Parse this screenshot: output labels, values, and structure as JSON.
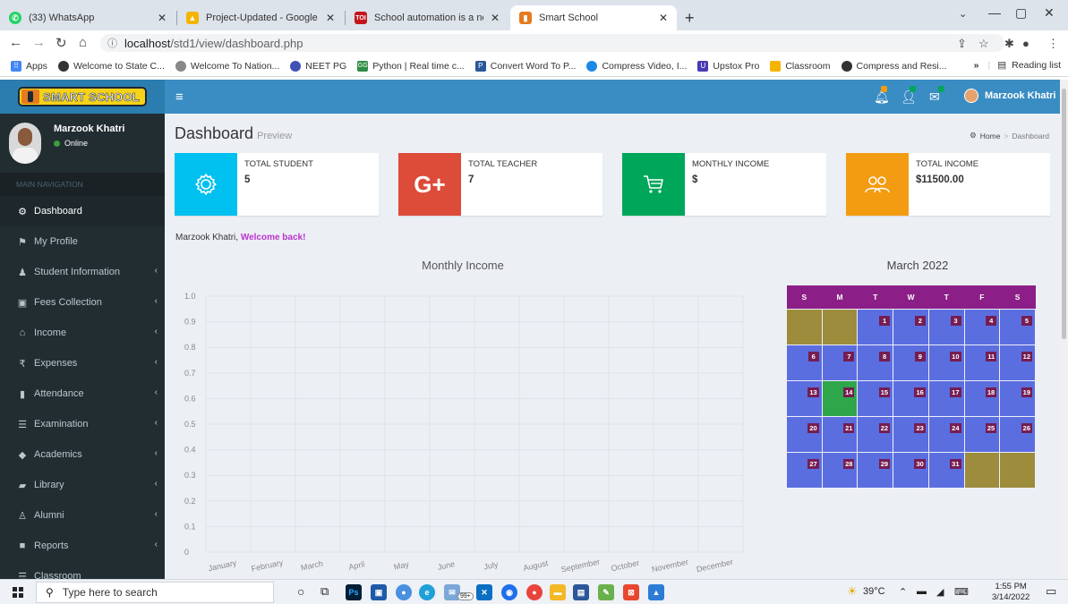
{
  "browser": {
    "tabs": [
      {
        "title": "(33) WhatsApp",
        "favicon": "whatsapp-icon",
        "color": "#25d366"
      },
      {
        "title": "Project-Updated - Google Drive",
        "favicon": "google-drive-icon",
        "color": "#f4b400"
      },
      {
        "title": "School automation is a new norm",
        "favicon": "toi-icon",
        "color": "#c4161c"
      },
      {
        "title": "Smart School",
        "favicon": "smart-school-icon",
        "color": "#e47b20"
      }
    ],
    "url_host": "localhost",
    "url_path": "/std1/view/dashboard.php",
    "bookmarks": [
      {
        "label": "Apps",
        "color": "#4285f4"
      },
      {
        "label": "Welcome to State C...",
        "color": "#333333"
      },
      {
        "label": "Welcome To Nation...",
        "color": "#888888"
      },
      {
        "label": "NEET PG",
        "color": "#3f51b5"
      },
      {
        "label": "Python | Real time c...",
        "color": "#2f8d46"
      },
      {
        "label": "Convert Word To P...",
        "color": "#2b579a"
      },
      {
        "label": "Compress Video, I...",
        "color": "#1e88e5"
      },
      {
        "label": "Upstox Pro",
        "color": "#4a3ab5"
      },
      {
        "label": "Classroom",
        "color": "#f4b400"
      },
      {
        "label": "Compress and Resi...",
        "color": "#333333"
      }
    ],
    "reading_list": "Reading list"
  },
  "app": {
    "logo_text": "SMART SCHOOL",
    "user_name": "Marzook Khatri"
  },
  "sidebar": {
    "user_name": "Marzook Khatri",
    "status": "Online",
    "nav_header": "MAIN NAVIGATION",
    "items": [
      {
        "label": "Dashboard",
        "icon": "dashboard-icon",
        "active": true,
        "arrow": false
      },
      {
        "label": "My Profile",
        "icon": "flag-icon",
        "active": false,
        "arrow": false
      },
      {
        "label": "Student Information",
        "icon": "user-icon",
        "active": false,
        "arrow": true
      },
      {
        "label": "Fees Collection",
        "icon": "money-icon",
        "active": false,
        "arrow": true
      },
      {
        "label": "Income",
        "icon": "bank-icon",
        "active": false,
        "arrow": true
      },
      {
        "label": "Expenses",
        "icon": "rupee-icon",
        "active": false,
        "arrow": true
      },
      {
        "label": "Attendance",
        "icon": "bookmark-icon",
        "active": false,
        "arrow": true
      },
      {
        "label": "Examination",
        "icon": "list-icon",
        "active": false,
        "arrow": true
      },
      {
        "label": "Academics",
        "icon": "tag-icon",
        "active": false,
        "arrow": true
      },
      {
        "label": "Library",
        "icon": "book-icon",
        "active": false,
        "arrow": true
      },
      {
        "label": "Alumni",
        "icon": "graduate-icon",
        "active": false,
        "arrow": true
      },
      {
        "label": "Reports",
        "icon": "briefcase-icon",
        "active": false,
        "arrow": true
      },
      {
        "label": "Classroom",
        "icon": "list-icon",
        "active": false,
        "arrow": false
      }
    ]
  },
  "page": {
    "title": "Dashboard",
    "subtitle": "Preview",
    "breadcrumb_home": "Home",
    "breadcrumb_current": "Dashboard"
  },
  "info_boxes": [
    {
      "label": "TOTAL STUDENT",
      "value": "5",
      "icon": "gear-icon",
      "color": "#00c0ef"
    },
    {
      "label": "TOTAL TEACHER",
      "value": "7",
      "icon": "google-plus-icon",
      "color": "#dd4b39"
    },
    {
      "label": "MONTHLY INCOME",
      "value": "$",
      "icon": "cart-icon",
      "color": "#00a65a"
    },
    {
      "label": "TOTAL INCOME",
      "value": "$11500.00",
      "icon": "users-icon",
      "color": "#f39c12"
    }
  ],
  "welcome": {
    "name": "Marzook Khatri,",
    "message": "Welcome back!"
  },
  "chart_data": {
    "type": "line",
    "title": "Monthly Income",
    "categories": [
      "January",
      "February",
      "March",
      "April",
      "May",
      "June",
      "July",
      "August",
      "September",
      "October",
      "November",
      "December"
    ],
    "series": [],
    "yticks": [
      "0",
      "0.1",
      "0.2",
      "0.3",
      "0.4",
      "0.5",
      "0.6",
      "0.7",
      "0.8",
      "0.9",
      "1.0"
    ],
    "ylim": [
      0,
      1
    ],
    "grid": true
  },
  "calendar": {
    "title": "March 2022",
    "weekdays": [
      "S",
      "M",
      "T",
      "W",
      "T",
      "F",
      "S"
    ],
    "weeks": [
      [
        "",
        "",
        "1",
        "2",
        "3",
        "4",
        "5"
      ],
      [
        "6",
        "7",
        "8",
        "9",
        "10",
        "11",
        "12"
      ],
      [
        "13",
        "14",
        "15",
        "16",
        "17",
        "18",
        "19"
      ],
      [
        "20",
        "21",
        "22",
        "23",
        "24",
        "25",
        "26"
      ],
      [
        "27",
        "28",
        "29",
        "30",
        "31",
        "",
        ""
      ]
    ],
    "today": "14"
  },
  "taskbar": {
    "search_placeholder": "Type here to search",
    "weather": "39°C",
    "time": "1:55 PM",
    "date": "3/14/2022",
    "badge": "99+"
  }
}
